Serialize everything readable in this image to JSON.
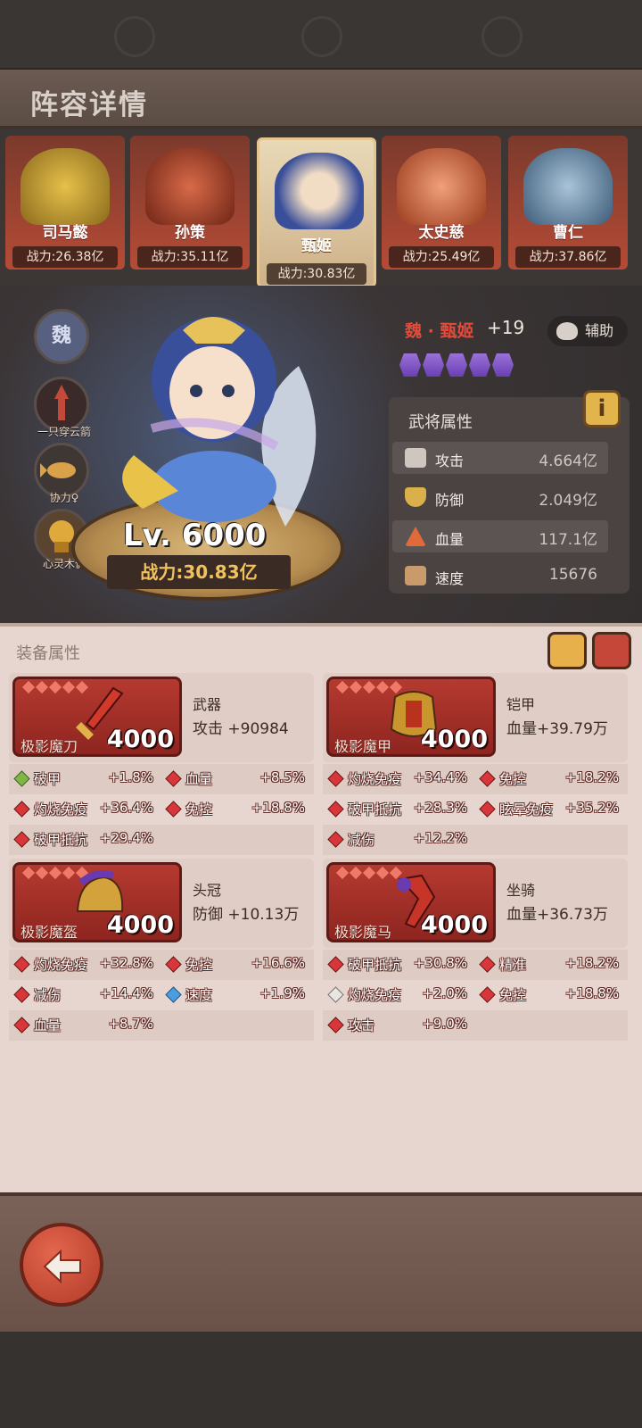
{
  "header": {
    "title": "阵容详情"
  },
  "heroes": [
    {
      "name": "司马懿",
      "power": "战力:26.38亿",
      "color": "#c8a338"
    },
    {
      "name": "孙策",
      "power": "战力:35.11亿",
      "color": "#b3452c"
    },
    {
      "name": "甄姬",
      "power": "战力:30.83亿",
      "color": "#5a7bc7",
      "selected": true
    },
    {
      "name": "太史慈",
      "power": "战力:25.49亿",
      "color": "#c94c2b"
    },
    {
      "name": "曹仁",
      "power": "战力:37.86亿",
      "color": "#6a8fb0"
    }
  ],
  "showcase": {
    "faction": "魏",
    "badges": [
      "一只穿云箭",
      "协力♀",
      "心灵木偶"
    ],
    "level": "Lv. 6000",
    "power": "战力:30.83亿",
    "hero_name": "魏 · 甄姬",
    "plus": "+19",
    "role": "辅助",
    "star_count": 5
  },
  "attributes": {
    "title": "武将属性",
    "info": "i",
    "rows": [
      {
        "name": "攻击",
        "value": "4.664亿",
        "icon": "sword-icon"
      },
      {
        "name": "防御",
        "value": "2.049亿",
        "icon": "shield-icon"
      },
      {
        "name": "血量",
        "value": "117.1亿",
        "icon": "hp-icon"
      },
      {
        "name": "速度",
        "value": "15676",
        "icon": "boot-icon"
      }
    ]
  },
  "equipment": {
    "title": "装备属性",
    "cards": [
      {
        "gear_name": "极影魔刀",
        "level": "4000",
        "slot": "武器",
        "main": "攻击 +90984",
        "subs": [
          [
            {
              "n": "破甲",
              "v": "+1.8%",
              "c": "g"
            },
            {
              "n": "血量",
              "v": "+8.5%",
              "c": "r"
            }
          ],
          [
            {
              "n": "灼烧免疫",
              "v": "+36.4%",
              "c": "r"
            },
            {
              "n": "免控",
              "v": "+18.8%",
              "c": "r"
            }
          ],
          [
            {
              "n": "破甲抵抗",
              "v": "+29.4%",
              "c": "r"
            }
          ]
        ]
      },
      {
        "gear_name": "极影魔甲",
        "level": "4000",
        "slot": "铠甲",
        "main": "血量+39.79万",
        "subs": [
          [
            {
              "n": "灼烧免疫",
              "v": "+34.4%",
              "c": "r"
            },
            {
              "n": "免控",
              "v": "+18.2%",
              "c": "r"
            }
          ],
          [
            {
              "n": "破甲抵抗",
              "v": "+28.3%",
              "c": "r"
            },
            {
              "n": "眩晕免疫",
              "v": "+35.2%",
              "c": "r"
            }
          ],
          [
            {
              "n": "减伤",
              "v": "+12.2%",
              "c": "r"
            }
          ]
        ]
      },
      {
        "gear_name": "极影魔盔",
        "level": "4000",
        "slot": "头冠",
        "main": "防御 +10.13万",
        "subs": [
          [
            {
              "n": "灼烧免疫",
              "v": "+32.8%",
              "c": "r"
            },
            {
              "n": "免控",
              "v": "+16.6%",
              "c": "r"
            }
          ],
          [
            {
              "n": "减伤",
              "v": "+14.4%",
              "c": "r"
            },
            {
              "n": "速度",
              "v": "+1.9%",
              "c": "b"
            }
          ],
          [
            {
              "n": "血量",
              "v": "+8.7%",
              "c": "r"
            }
          ]
        ]
      },
      {
        "gear_name": "极影魔马",
        "level": "4000",
        "slot": "坐骑",
        "main": "血量+36.73万",
        "subs": [
          [
            {
              "n": "破甲抵抗",
              "v": "+30.8%",
              "c": "r"
            },
            {
              "n": "精准",
              "v": "+18.2%",
              "c": "r"
            }
          ],
          [
            {
              "n": "灼烧免疫",
              "v": "+2.0%",
              "c": "w"
            },
            {
              "n": "免控",
              "v": "+18.8%",
              "c": "r"
            }
          ],
          [
            {
              "n": "攻击",
              "v": "+9.0%",
              "c": "r"
            }
          ]
        ]
      }
    ]
  },
  "colors": {
    "accent": "#e24a3a",
    "gold": "#f2c25a",
    "panel": "#4a4342"
  }
}
